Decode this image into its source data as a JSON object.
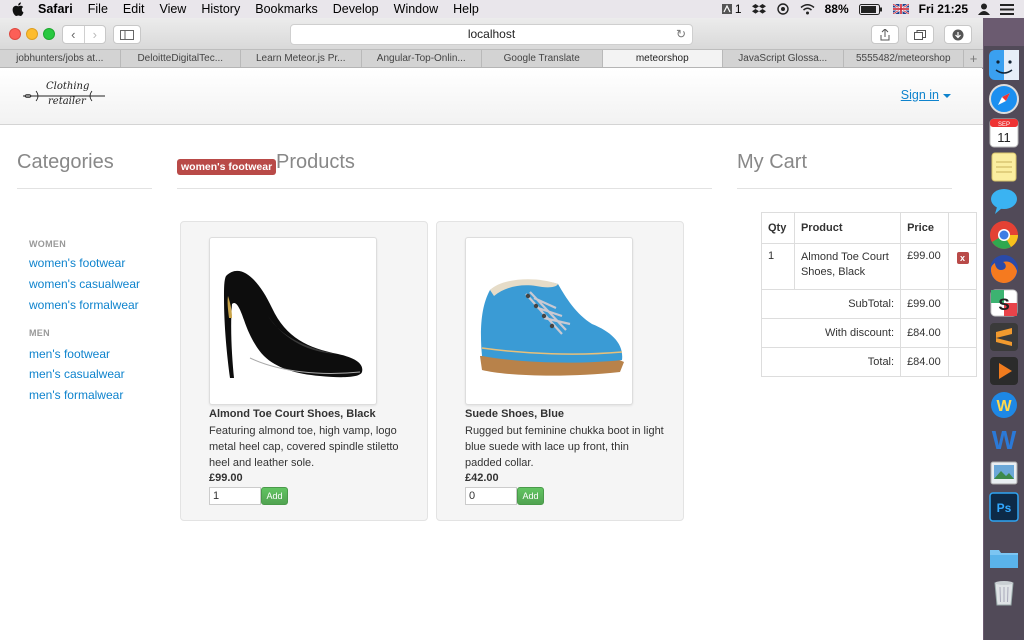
{
  "menubar": {
    "app": "Safari",
    "items": [
      "File",
      "Edit",
      "View",
      "History",
      "Bookmarks",
      "Develop",
      "Window",
      "Help"
    ],
    "status_num": "1",
    "battery": "88%",
    "clock": "Fri 21:25"
  },
  "browser": {
    "url": "localhost",
    "tabs": [
      "jobhunters/jobs at...",
      "DeloitteDigitalTec...",
      "Learn Meteor.js Pr...",
      "Angular-Top-Onlin...",
      "Google Translate",
      "meteorshop",
      "JavaScript Glossa...",
      "5555482/meteorshop"
    ],
    "active_tab": 5
  },
  "site": {
    "logo_line1": "Clothing",
    "logo_line2": "retailer",
    "signin": "Sign in"
  },
  "categories": {
    "title": "Categories",
    "groups": [
      {
        "heading": "WOMEN",
        "links": [
          "women's footwear",
          "women's casualwear",
          "women's formalwear"
        ]
      },
      {
        "heading": "MEN",
        "links": [
          "men's footwear",
          "men's casualwear",
          "men's formalwear"
        ]
      }
    ]
  },
  "products": {
    "badge": "women's footwear",
    "title": "Products",
    "items": [
      {
        "name": "Almond Toe Court Shoes, Black",
        "desc": "Featuring almond toe, high vamp, logo metal heel cap, covered spindle stiletto heel and leather sole.",
        "price": "£99.00",
        "qty": "1",
        "add": "Add"
      },
      {
        "name": "Suede Shoes, Blue",
        "desc": "Rugged but feminine chukka boot in light blue suede with lace up front, thin padded collar.",
        "price": "£42.00",
        "qty": "0",
        "add": "Add"
      }
    ]
  },
  "cart": {
    "title": "My Cart",
    "headers": {
      "qty": "Qty",
      "product": "Product",
      "price": "Price"
    },
    "items": [
      {
        "qty": "1",
        "product": "Almond Toe Court Shoes, Black",
        "price": "£99.00",
        "remove": "x"
      }
    ],
    "subtotal_label": "SubTotal:",
    "subtotal": "£99.00",
    "discount_label": "With discount:",
    "discount": "£84.00",
    "total_label": "Total:",
    "total": "£84.00"
  },
  "dock": {
    "calendar_month": "SEP",
    "calendar_day": "11"
  }
}
